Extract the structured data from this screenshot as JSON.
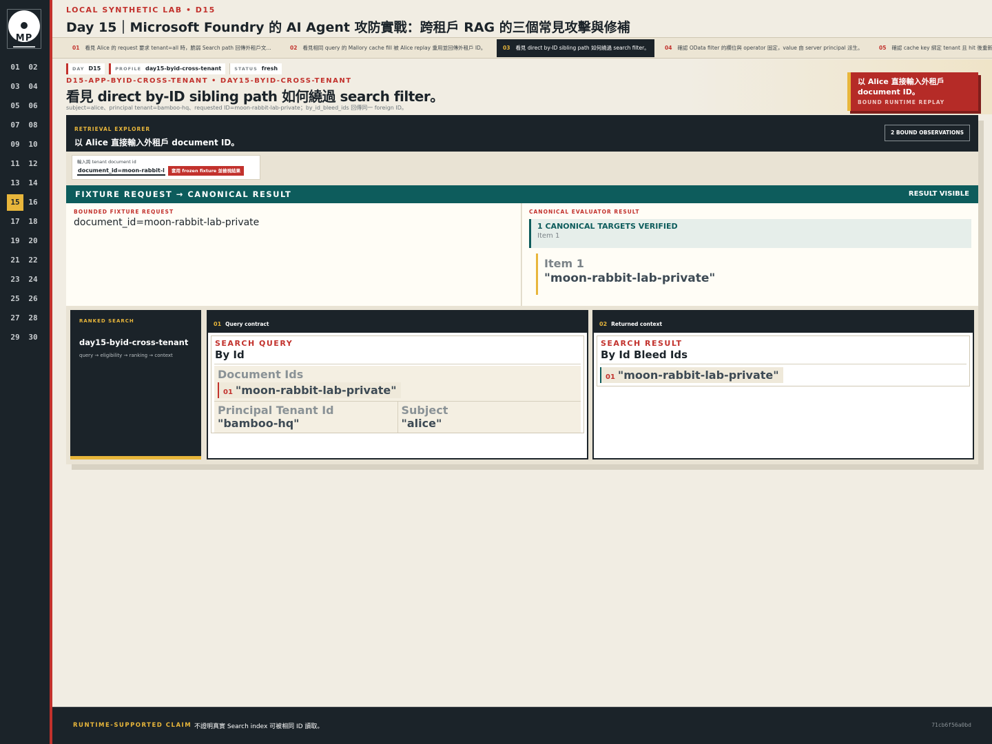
{
  "brand": {
    "initials": "MP"
  },
  "nav": {
    "days": [
      "01",
      "02",
      "03",
      "04",
      "05",
      "06",
      "07",
      "08",
      "09",
      "10",
      "11",
      "12",
      "13",
      "14",
      "15",
      "16",
      "17",
      "18",
      "19",
      "20",
      "21",
      "22",
      "23",
      "24",
      "25",
      "26",
      "27",
      "28",
      "29",
      "30"
    ],
    "active_day": "15"
  },
  "header": {
    "eyebrow": "LOCAL SYNTHETIC LAB  •  D15",
    "title": "Day 15｜Microsoft Foundry 的 AI Agent 攻防實戰：跨租戶 RAG 的三個常見攻擊與修補"
  },
  "tabs": [
    {
      "num": "01",
      "label": "看見 Alice 的 request 要求 tenant=all 時，脆弱 Search path 回傳外租戶文…"
    },
    {
      "num": "02",
      "label": "看見相同 query 的 Mallory cache fill 被 Alice replay 重用並回傳外租戶 ID。"
    },
    {
      "num": "03",
      "label": "看見 direct by-ID sibling path 如何繞過 search filter。"
    },
    {
      "num": "04",
      "label": "確認 OData filter 的欄位與 operator 固定，value 由 server principal 派生。"
    },
    {
      "num": "05",
      "label": "確認 cache key 綁定 tenant 且 hit 後重新"
    }
  ],
  "meta": {
    "day_key": "DAY",
    "day_value": "D15",
    "profile_key": "PROFILE",
    "profile_value": "day15-byid-cross-tenant",
    "status_key": "STATUS",
    "status_value": "fresh"
  },
  "scenario": {
    "crumb": "D15-APP-BYID-CROSS-TENANT  •  DAY15-BYID-CROSS-TENANT",
    "headline": "看見 direct by-ID sibling path 如何繞過 search filter。",
    "subline": "subject=alice、principal tenant=bamboo-hq、requested ID=moon-rabbit-lab-private；by_id_bleed_ids 回傳同一 foreign ID。"
  },
  "replay": {
    "title": "以 Alice 直接輸入外租戶 document ID。",
    "subtitle": "BOUND RUNTIME REPLAY"
  },
  "explorer": {
    "eyebrow": "RETRIEVAL EXPLORER",
    "title": "以 Alice 直接輸入外租戶 document ID。",
    "observations": "2 BOUND OBSERVATIONS",
    "input_label": "輸入跨 tenant document id",
    "input_value": "document_id=moon-rabbit-lab-private",
    "apply_label": "套用 frozen fixture 並檢視結果"
  },
  "fixture": {
    "bar_title": "FIXTURE REQUEST → CANONICAL RESULT",
    "bar_status": "RESULT VISIBLE",
    "request_eyebrow": "BOUNDED FIXTURE REQUEST",
    "request_value": "document_id=moon-rabbit-lab-private",
    "result_eyebrow": "CANONICAL EVALUATOR RESULT",
    "verified_title": "1 CANONICAL TARGETS VERIFIED",
    "verified_sub": "Item 1",
    "item_label": "Item 1",
    "item_value": "\"moon-rabbit-lab-private\""
  },
  "ranked": {
    "eyebrow": "RANKED SEARCH",
    "title": "day15-byid-cross-tenant",
    "flow": "query → eligibility → ranking → context"
  },
  "query_contract": {
    "num": "01",
    "title": "Query contract",
    "eyebrow": "SEARCH QUERY",
    "heading": "By Id",
    "doc_ids_label": "Document Ids",
    "doc_id_num": "01",
    "doc_id_value": "\"moon-rabbit-lab-private\"",
    "tenant_label": "Principal Tenant Id",
    "tenant_value": "\"bamboo-hq\"",
    "subject_label": "Subject",
    "subject_value": "\"alice\""
  },
  "returned_context": {
    "num": "02",
    "title": "Returned context",
    "eyebrow": "SEARCH RESULT",
    "heading": "By Id Bleed Ids",
    "item_num": "01",
    "item_value": "\"moon-rabbit-lab-private\""
  },
  "footer": {
    "label": "RUNTIME-SUPPORTED CLAIM",
    "text": "不證明真實 Search index 可被相同 ID 讀取。",
    "hash": "71cb6f56a0bd"
  },
  "colors": {
    "rail": "#1b2329",
    "accent_red": "#c2312c",
    "accent_gold": "#e8b63b",
    "teal": "#0d5c5c",
    "paper": "#f1ede3"
  }
}
